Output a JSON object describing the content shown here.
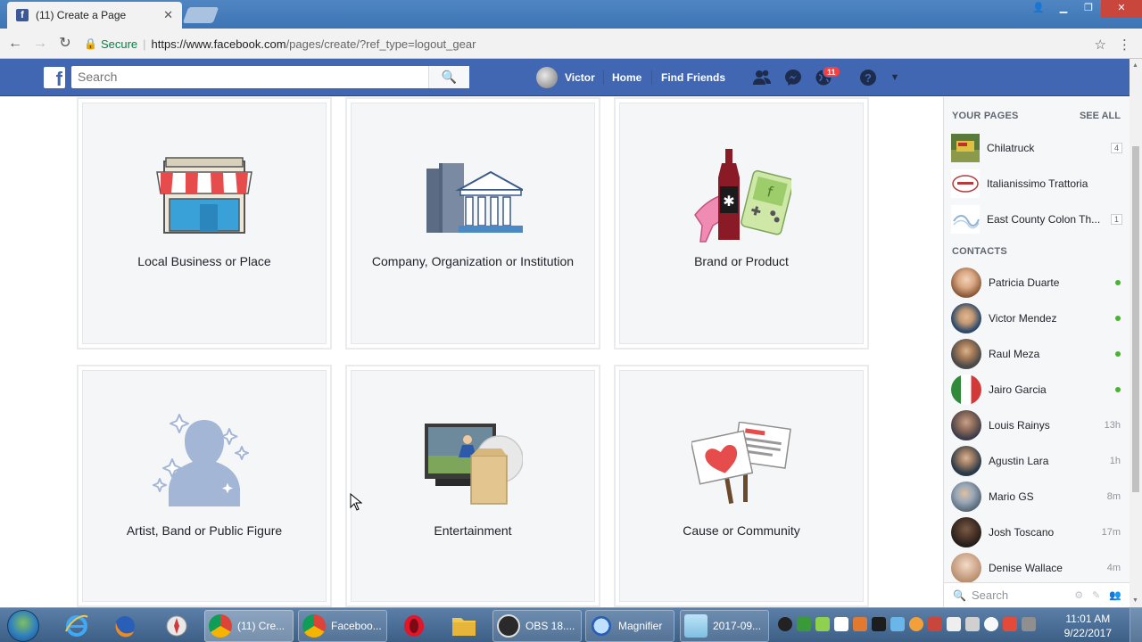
{
  "browser": {
    "tab_title": "(11) Create a Page",
    "tab_favicon": "f",
    "secure_label": "Secure",
    "url_host": "https://www.facebook.com",
    "url_path": "/pages/create/?ref_type=logout_gear"
  },
  "fb": {
    "search_placeholder": "Search",
    "user_name": "Victor",
    "nav_home": "Home",
    "nav_find_friends": "Find Friends",
    "notification_count": "11",
    "brand_color": "#4267b2"
  },
  "categories": [
    {
      "label": "Local Business or Place",
      "icon": "storefront-icon"
    },
    {
      "label": "Company, Organization or Institution",
      "icon": "building-icon"
    },
    {
      "label": "Brand or Product",
      "icon": "products-icon"
    },
    {
      "label": "Artist, Band or Public Figure",
      "icon": "person-silhouette-icon"
    },
    {
      "label": "Entertainment",
      "icon": "movie-screen-icon"
    },
    {
      "label": "Cause or Community",
      "icon": "protest-signs-icon"
    }
  ],
  "sidebar": {
    "your_pages_header": "YOUR PAGES",
    "see_all": "SEE ALL",
    "pages": [
      {
        "name": "Chilatruck",
        "count": "4"
      },
      {
        "name": "Italianissimo Trattoria",
        "count": ""
      },
      {
        "name": "East County Colon Th...",
        "count": "1"
      }
    ],
    "contacts_header": "CONTACTS",
    "contacts": [
      {
        "name": "Patricia Duarte",
        "status": "online"
      },
      {
        "name": "Victor Mendez",
        "status": "online"
      },
      {
        "name": "Raul Meza",
        "status": "online"
      },
      {
        "name": "Jairo Garcia",
        "status": "online"
      },
      {
        "name": "Louis Rainys",
        "status": "13h"
      },
      {
        "name": "Agustin Lara",
        "status": "1h"
      },
      {
        "name": "Mario GS",
        "status": "8m"
      },
      {
        "name": "Josh Toscano",
        "status": "17m"
      },
      {
        "name": "Denise Wallace",
        "status": "4m"
      }
    ],
    "search_placeholder": "Search"
  },
  "taskbar": {
    "apps": [
      {
        "label": "(11) Cre...",
        "icon": "chrome-icon"
      },
      {
        "label": "Faceboo...",
        "icon": "chrome-icon"
      },
      {
        "label": "OBS 18....",
        "icon": "obs-icon"
      },
      {
        "label": "Magnifier",
        "icon": "magnifier-icon"
      },
      {
        "label": "2017-09...",
        "icon": "notepad-icon"
      }
    ],
    "time": "11:01 AM",
    "date": "9/22/2017"
  }
}
